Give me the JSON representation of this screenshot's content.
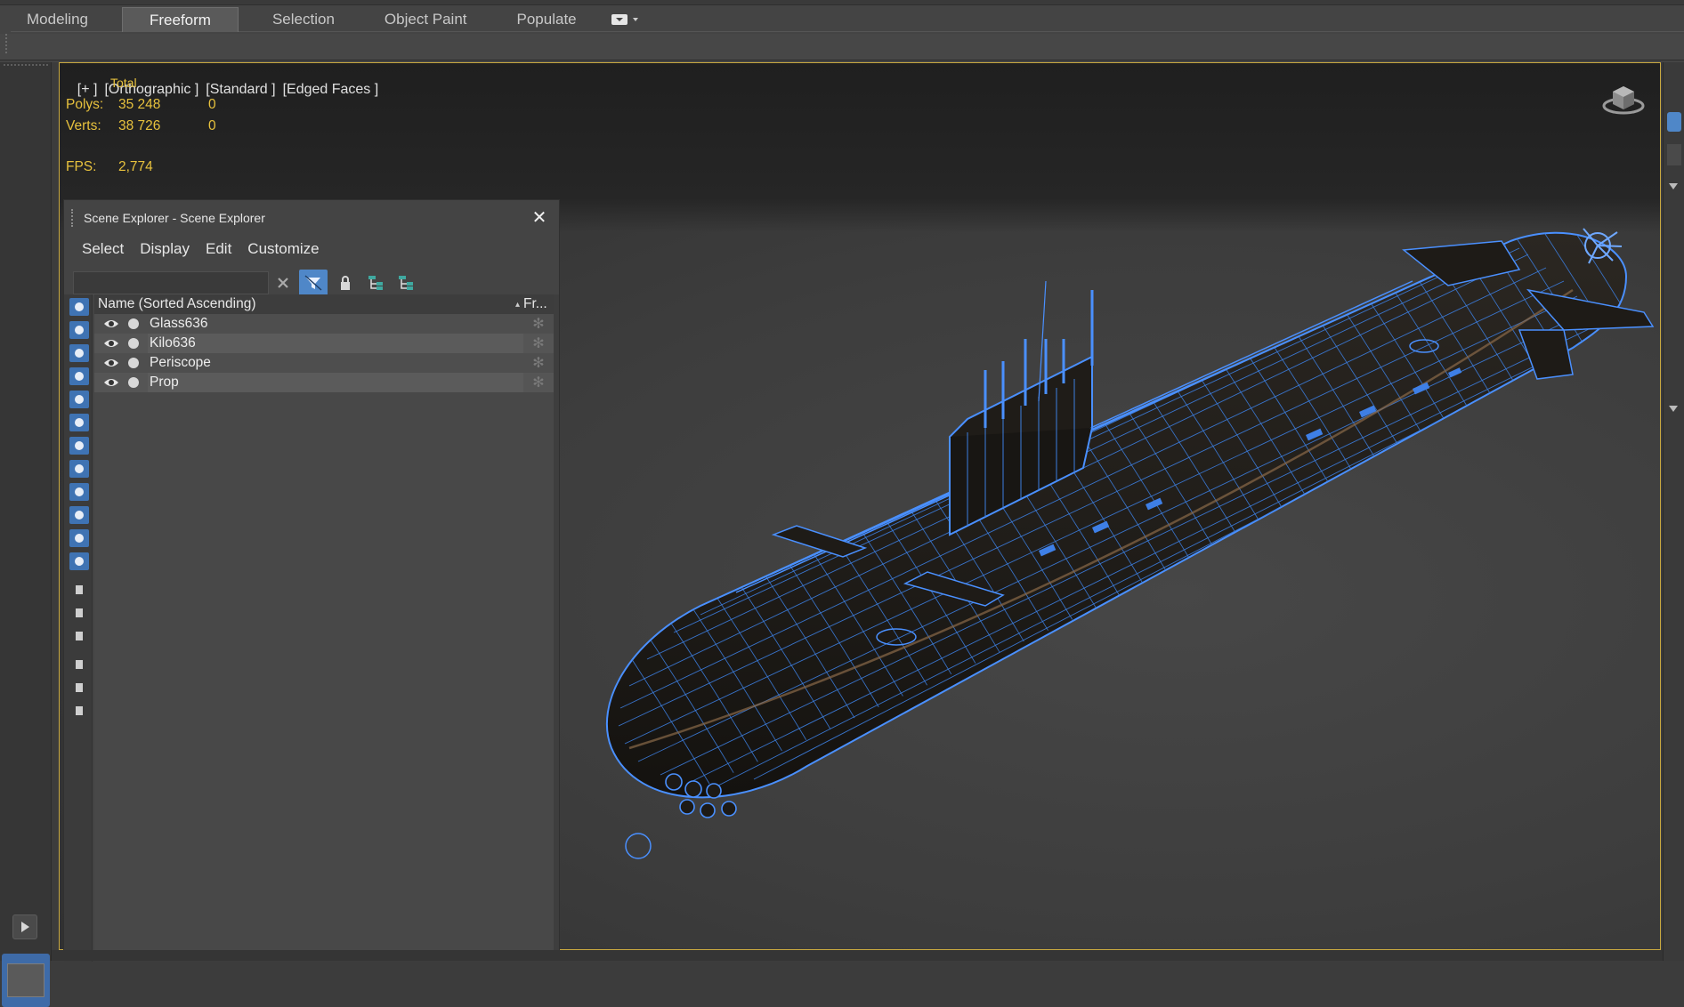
{
  "ribbon": {
    "tabs": [
      {
        "label": "Modeling",
        "active": false
      },
      {
        "label": "Freeform",
        "active": true
      },
      {
        "label": "Selection",
        "active": false
      },
      {
        "label": "Object Paint",
        "active": false
      },
      {
        "label": "Populate",
        "active": false
      }
    ],
    "extra_icon": "ribbon-options-icon"
  },
  "viewport": {
    "label_plus": "[+ ]",
    "label_view": "[Orthographic ]",
    "label_shading": "[Standard ]",
    "label_edges": "[Edged Faces ]",
    "stats": {
      "total_label": "Total",
      "polys_label": "Polys:",
      "polys_total": "35 248",
      "polys_sel": "0",
      "verts_label": "Verts:",
      "verts_total": "38 726",
      "verts_sel": "0",
      "fps_label": "FPS:",
      "fps_value": "2,774"
    },
    "colors": {
      "stats_text": "#e7c13d",
      "active_border": "#c9a940",
      "wire": "#4a90ff"
    },
    "model_icon": "submarine-wireframe",
    "viewcube_icon": "viewcube-icon"
  },
  "scene_explorer": {
    "title": "Scene Explorer - Scene Explorer",
    "close_icon": "close-icon",
    "menu": [
      "Select",
      "Display",
      "Edit",
      "Customize"
    ],
    "search_value": "",
    "toolbar_icons": [
      "clear-search-icon",
      "filter-icon",
      "lock-icon",
      "hierarchy-icon",
      "hierarchy-sort-icon"
    ],
    "column_name": "Name (Sorted Ascending)",
    "column_sort_indicator": "▴",
    "column_frozen": "Fr...",
    "rows": [
      {
        "name": "Glass636",
        "visible": true
      },
      {
        "name": "Kilo636",
        "visible": true
      },
      {
        "name": "Periscope",
        "visible": true
      },
      {
        "name": "Prop",
        "visible": true
      }
    ],
    "side_icons": [
      "geometry-filter-icon",
      "shapes-filter-icon",
      "lights-filter-icon",
      "cameras-filter-icon",
      "helpers-filter-icon",
      "spacewarps-filter-icon",
      "groups-filter-icon",
      "xrefs-filter-icon",
      "bones-filter-icon",
      "containers-filter-icon",
      "frozen-filter-icon",
      "hidden-filter-icon",
      "select-all-icon",
      "select-none-icon",
      "select-invert-icon",
      "filter-settings-icon",
      "filter-toggle-icon",
      "layers-icon"
    ]
  },
  "left_toolbar": {
    "play_icon": "play-icon"
  }
}
